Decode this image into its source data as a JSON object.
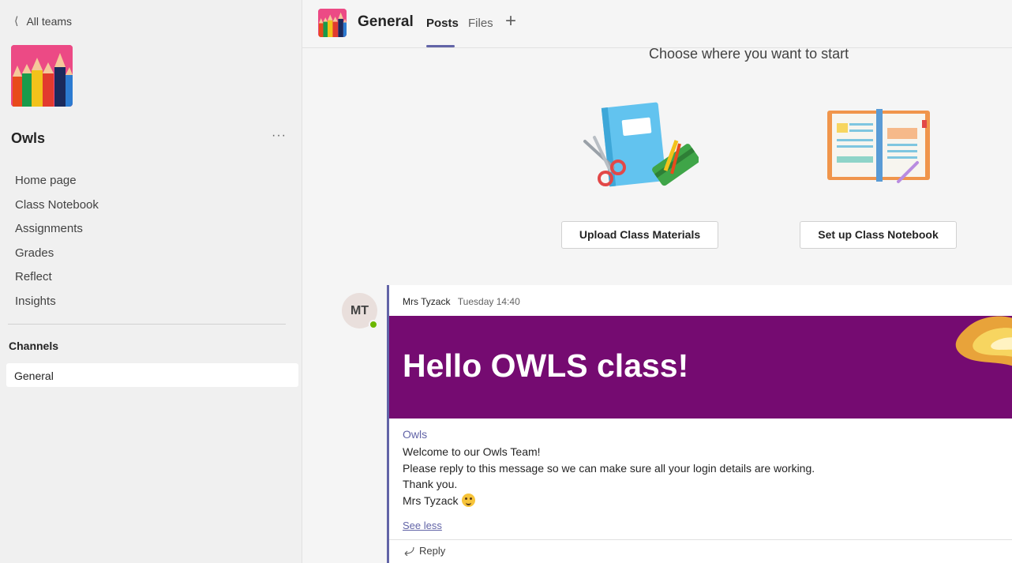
{
  "sidebar": {
    "back_label": "All teams",
    "team_name": "Owls",
    "more_label": "···",
    "nav_items": [
      {
        "label": "Home page"
      },
      {
        "label": "Class Notebook"
      },
      {
        "label": "Assignments"
      },
      {
        "label": "Grades"
      },
      {
        "label": "Reflect"
      },
      {
        "label": "Insights"
      }
    ],
    "channels_title": "Channels",
    "channels": [
      {
        "label": "General",
        "selected": true
      }
    ]
  },
  "header": {
    "channel_title": "General",
    "tabs": [
      {
        "label": "Posts",
        "active": true
      },
      {
        "label": "Files"
      }
    ],
    "add_tab_icon": "plus-icon"
  },
  "main": {
    "start_title": "Choose where you want to start",
    "upload_button": "Upload Class Materials",
    "notebook_button": "Set up Class Notebook"
  },
  "post": {
    "avatar_initials": "MT",
    "author": "Mrs Tyzack",
    "time": "Tuesday 14:40",
    "banner_text": "Hello OWLS class!",
    "subject": "Owls",
    "body_lines": [
      "Welcome to our Owls Team!",
      "Please reply to this message so we can make sure all your login details are working.",
      "Thank you.",
      "Mrs Tyzack"
    ],
    "see_less": "See less",
    "reply_label": "Reply"
  },
  "colors": {
    "accent": "#6264a7",
    "banner": "#750b71",
    "team_tile": "#ec4a85",
    "presence": "#6bb700"
  }
}
